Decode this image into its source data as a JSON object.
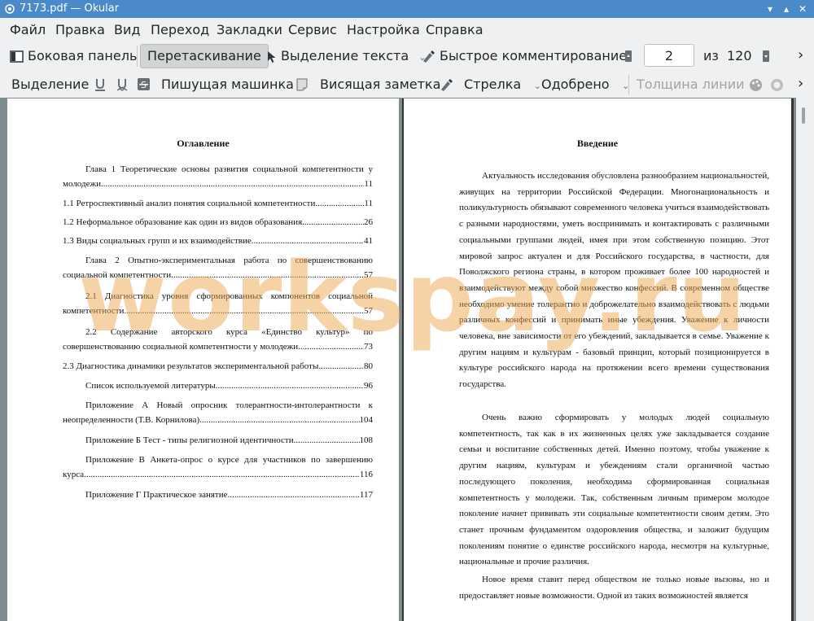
{
  "window": {
    "title": "7173.pdf  — Okular"
  },
  "menu": [
    "Файл",
    "Правка",
    "Вид",
    "Переход",
    "Закладки",
    "Сервис",
    "Настройка",
    "Справка"
  ],
  "toolbar1": {
    "sidebar": "Боковая панель",
    "browse": "Перетаскивание",
    "text_select": "Выделение текста",
    "quick_annot": "Быстрое комментирование",
    "page_current": "2",
    "page_of": "из",
    "page_total": "120",
    "more": "›"
  },
  "toolbar2": {
    "highlight": "Выделение",
    "typewriter": "Пишущая машинка",
    "popup_note": "Висящая заметка",
    "arrow": "Стрелка",
    "stamp": "Одобрено",
    "line_width": "Толщина линии",
    "more": "›"
  },
  "page1": {
    "title": "Оглавление",
    "toc": [
      {
        "first": "Глава 1 Теоретические основы развития социальной компетентности у",
        "label": "молодежи",
        "page": "11"
      },
      {
        "label": "1.1 Ретроспективный анализ понятия социальной компетентности",
        "page": "11"
      },
      {
        "label": "1.2 Неформальное образование как один из видов образования",
        "page": "26"
      },
      {
        "label": "1.3 Виды социальных групп и их взаимодействие",
        "page": "41"
      },
      {
        "first": "Глава 2 Опытно-экспериментальная работа по совершенствованию",
        "label": "социальной компетентности",
        "page": "57"
      },
      {
        "first": "2.1  Диагностика уровня сформированных компонентов социальной",
        "label": "компетентности",
        "page": "57"
      },
      {
        "first": "2.2   Содержание авторского курса «Единство культур» по",
        "label": "совершенствованию социальной компетентности у молодежи",
        "page": "73"
      },
      {
        "label": "2.3  Диагностика динамики результатов экспериментальной работы",
        "page": "80"
      },
      {
        "label": "Список используемой литературы",
        "page": "96"
      },
      {
        "first": "Приложение А Новый опросник толерантности-интолерантности к",
        "label": "неопределенности (Т.В. Корнилова)",
        "page": "104"
      },
      {
        "label": "Приложение Б Тест - типы религиозной идентичности",
        "page": "108"
      },
      {
        "first": "Приложение В Анкета-опрос о курсе для участников по завершению",
        "label": "курса",
        "page": "116"
      },
      {
        "label": "Приложение Г Практическое занятие",
        "page": "117"
      }
    ]
  },
  "page2": {
    "title": "Введение",
    "paragraphs": [
      "Актуальность исследования обусловлена разнообразием национальностей, живущих на территории Российской Федерации. Многонациональность и поликультурность обязывают современного человека учиться взаимодействовать с разными народностями, уметь воспринимать и контактировать с различными социальными группами людей, имея при этом собственную позицию. Этот мировой запрос актуален и для Российского государства, в частности, для Поволжского региона страны, в котором проживает более 100 народностей и взаимодействуют между собой множество конфессий. В современном обществе необходимо умение толерантно и доброжелательно взаимодействовать с людьми различных конфессий и принимать иные убеждения. Уважение к личности человека, вне зависимости от его убеждений, закладывается в семье. Уважение к другим нациям и культурам - базовый принцип, который позиционируется в культуре российского народа на протяжении всего времени существования государства.",
      "Очень важно сформировать у молодых людей социальную компетентность, так как в их жизненных целях уже закладывается создание семьи и воспитание собственных детей. Именно поэтому, чтобы уважение к другим нациям, культурам и убеждениям стали органичной частью последующего поколения, необходима сформированная социальная компетентность у молодежи. Так, собственным личным примером молодое поколение начнет прививать эти социальные компетентности своим детям. Это станет прочным фундаментом оздоровления общества, и заложит будущим поколениям понятие о единстве российского народа, несмотря на культурные, национальные и прочие различия.",
      "Новое время ставит перед обществом не только новые вызовы, но и предоставляет новые возможности. Одной из таких возможностей является"
    ]
  },
  "watermark": "workspay.ru",
  "colors": {
    "titlebar": "#4a8ac8",
    "doc_bg": "#7f8c8d",
    "watermark": "#eca850"
  }
}
